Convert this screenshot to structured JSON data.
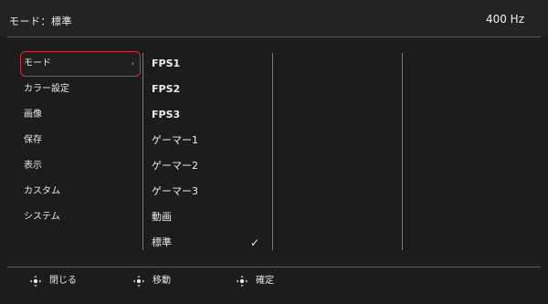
{
  "header": {
    "mode_title": "モード：標準",
    "refresh_rate": "400 Hz"
  },
  "menu": {
    "items": [
      {
        "label": "モード"
      },
      {
        "label": "カラー設定"
      },
      {
        "label": "画像"
      },
      {
        "label": "保存"
      },
      {
        "label": "表示"
      },
      {
        "label": "カスタム"
      },
      {
        "label": "システム"
      }
    ],
    "selected_index": 0
  },
  "options": {
    "items": [
      {
        "label": "FPS1"
      },
      {
        "label": "FPS2"
      },
      {
        "label": "FPS3"
      },
      {
        "label": "ゲーマー1"
      },
      {
        "label": "ゲーマー2"
      },
      {
        "label": "ゲーマー3"
      },
      {
        "label": "動画"
      },
      {
        "label": "標準"
      }
    ],
    "checked": "標準"
  },
  "footer": {
    "close_label": "閉じる",
    "move_label": "移動",
    "confirm_label": "確定"
  },
  "colors": {
    "selection_border": "#c8343a",
    "background": "#1c1c1c"
  },
  "icons": {
    "check": "checkmark-icon",
    "joystick": "joystick-icon",
    "chevron": "chevron-right-icon"
  }
}
